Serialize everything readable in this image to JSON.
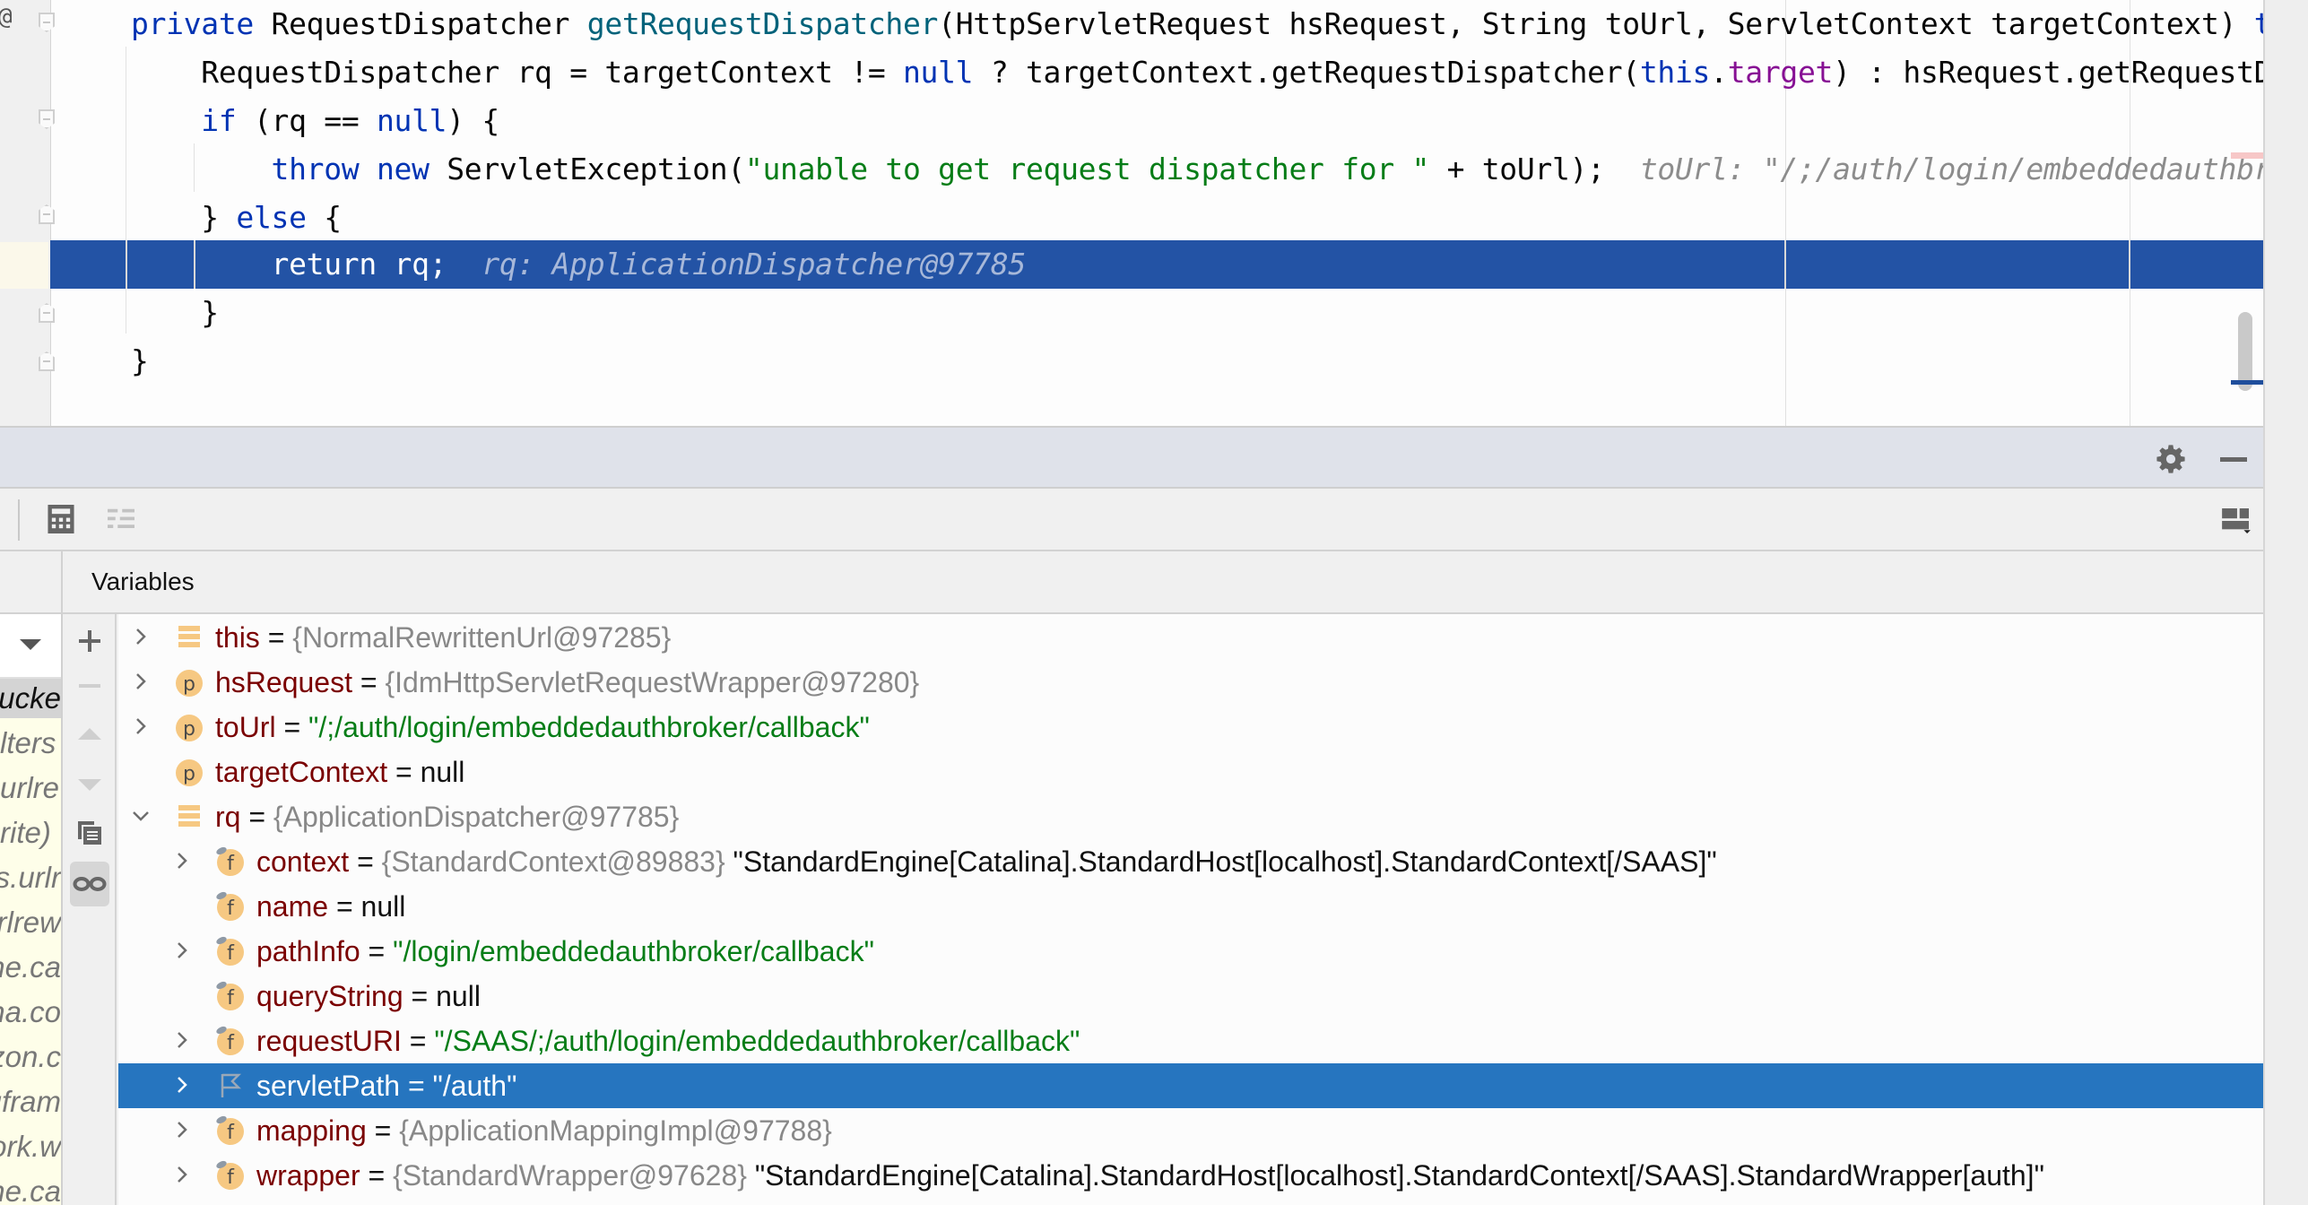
{
  "editor": {
    "gutter_marker": "@",
    "lines": [
      {
        "segments": [
          [
            "kw",
            "private "
          ],
          [
            "",
            "RequestDispatcher "
          ],
          [
            "fn",
            "getRequestDispatcher"
          ],
          [
            "",
            "(HttpServletRequest hsRequest, String toUrl, ServletContext targetContext) "
          ],
          [
            "kw",
            "thr"
          ]
        ]
      },
      {
        "segments": [
          [
            "",
            "    RequestDispatcher rq = targetContext != "
          ],
          [
            "kw",
            "null"
          ],
          [
            "",
            " ? targetContext.getRequestDispatcher("
          ],
          [
            "kw",
            "this"
          ],
          [
            "",
            "."
          ],
          [
            "fld",
            "target"
          ],
          [
            "",
            ") : hsRequest.getRequestDis"
          ]
        ]
      },
      {
        "segments": [
          [
            "",
            "    "
          ],
          [
            "kw",
            "if"
          ],
          [
            "",
            " (rq == "
          ],
          [
            "kw",
            "null"
          ],
          [
            "",
            ") {"
          ]
        ]
      },
      {
        "segments": [
          [
            "",
            "        "
          ],
          [
            "kw",
            "throw new "
          ],
          [
            "",
            "ServletException("
          ],
          [
            "str",
            "\"unable to get request dispatcher for \""
          ],
          [
            "",
            " + toUrl);  "
          ],
          [
            "hint",
            "toUrl: \"/;/auth/login/embeddedauthbrok"
          ]
        ]
      },
      {
        "segments": [
          [
            "",
            "    } "
          ],
          [
            "kw",
            "else"
          ],
          [
            "",
            " {"
          ]
        ]
      },
      {
        "segments": [
          [
            "",
            "        return rq;  "
          ],
          [
            "hint",
            "rq: ApplicationDispatcher@97785"
          ]
        ],
        "execution_point": true
      },
      {
        "segments": [
          [
            "",
            "    }"
          ]
        ]
      },
      {
        "segments": [
          [
            "",
            "}"
          ]
        ]
      }
    ]
  },
  "debugger": {
    "header_icons": [
      "gear-icon",
      "minimize-icon"
    ],
    "toolbar_icons": [
      "evaluate-expression-icon",
      "trace-stream-icon",
      "layout-options-icon"
    ],
    "variables_title": "Variables",
    "frames": [
      {
        "text": "ucke",
        "selected": true
      },
      {
        "text": "lters"
      },
      {
        "text": "urlre"
      },
      {
        "text": "rite)"
      },
      {
        "text": "s.urlr"
      },
      {
        "text": "rlrew"
      },
      {
        "text": "he.ca"
      },
      {
        "text": "na.co"
      },
      {
        "text": "zon.c"
      },
      {
        "text": "ufram"
      },
      {
        "text": "ork.w"
      },
      {
        "text": "he.ca"
      }
    ],
    "side_tools": [
      "add-watch-icon",
      "remove-watch-icon",
      "move-up-icon",
      "move-down-icon",
      "duplicate-watch-icon",
      "show-watches-icon"
    ],
    "variables": [
      {
        "depth": 0,
        "expand": "collapsed",
        "icon": "stack",
        "name": "this",
        "type": "{NormalRewrittenUrl@97285}"
      },
      {
        "depth": 0,
        "expand": "collapsed",
        "icon": "param",
        "name": "hsRequest",
        "type": "{IdmHttpServletRequestWrapper@97280}"
      },
      {
        "depth": 0,
        "expand": "collapsed",
        "icon": "param",
        "name": "toUrl",
        "str": "\"/;/auth/login/embeddedauthbroker/callback\""
      },
      {
        "depth": 0,
        "expand": "none",
        "icon": "param",
        "name": "targetContext",
        "null": "null"
      },
      {
        "depth": 0,
        "expand": "expanded",
        "icon": "stack",
        "name": "rq",
        "type": "{ApplicationDispatcher@97785}"
      },
      {
        "depth": 1,
        "expand": "collapsed",
        "icon": "field",
        "name": "context",
        "type": "{StandardContext@89883}",
        "desc": "\"StandardEngine[Catalina].StandardHost[localhost].StandardContext[/SAAS]\""
      },
      {
        "depth": 1,
        "expand": "none",
        "icon": "field",
        "name": "name",
        "null": "null"
      },
      {
        "depth": 1,
        "expand": "collapsed",
        "icon": "field",
        "name": "pathInfo",
        "str": "\"/login/embeddedauthbroker/callback\""
      },
      {
        "depth": 1,
        "expand": "none",
        "icon": "field",
        "name": "queryString",
        "null": "null"
      },
      {
        "depth": 1,
        "expand": "collapsed",
        "icon": "field",
        "name": "requestURI",
        "str": "\"/SAAS/;/auth/login/embeddedauthbroker/callback\""
      },
      {
        "depth": 1,
        "expand": "collapsed",
        "icon": "flag",
        "name": "servletPath",
        "str": "\"/auth\"",
        "selected": true
      },
      {
        "depth": 1,
        "expand": "collapsed",
        "icon": "field",
        "name": "mapping",
        "type": "{ApplicationMappingImpl@97788}"
      },
      {
        "depth": 1,
        "expand": "collapsed",
        "icon": "field",
        "name": "wrapper",
        "type": "{StandardWrapper@97628}",
        "desc": "\"StandardEngine[Catalina].StandardHost[localhost].StandardContext[/SAAS].StandardWrapper[auth]\""
      }
    ],
    "equals": "=",
    "icon_letters": {
      "param": "p",
      "field": "f"
    }
  },
  "colors": {
    "execution_line": "#2353a5",
    "selected_row": "#2675bf",
    "keyword": "#0033b3",
    "string": "#067d17",
    "var_name": "#7a0000",
    "icon_orange": "#f6c882"
  }
}
